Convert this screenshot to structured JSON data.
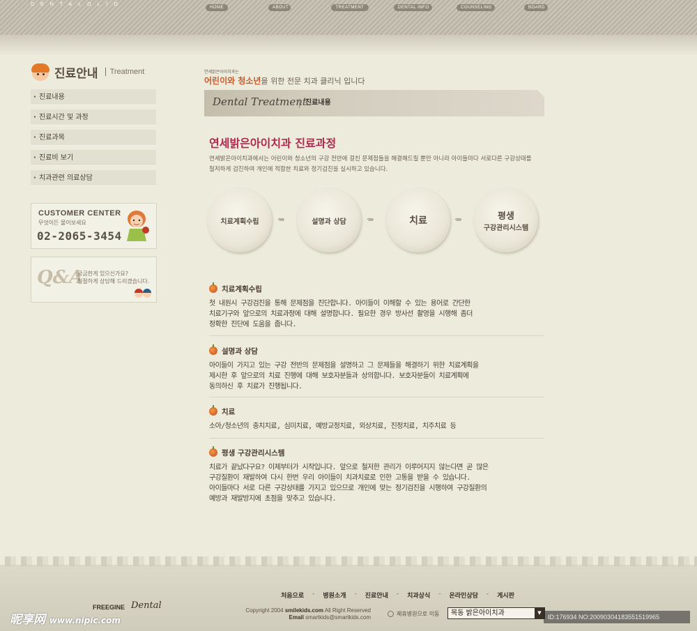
{
  "header": {
    "logo_text": "DENTALOLIO",
    "nav": [
      "HOME",
      "ABOUT",
      "TREATMENT",
      "DENTAL INFO",
      "COUNSELING",
      "BOARD"
    ]
  },
  "sidebar": {
    "title_ko": "진료안내",
    "title_en": "Treatment",
    "items": [
      {
        "label": "진료내용"
      },
      {
        "label": "진료시간 및 과정"
      },
      {
        "label": "진료과목"
      },
      {
        "label": "진료비 보기"
      },
      {
        "label": "치과관련 의료상담"
      }
    ],
    "customer_center": {
      "title": "CUSTOMER CENTER",
      "subtitle": "무엇이든 물어보세요",
      "phone": "02-2065-3454"
    },
    "qa": {
      "logo": "Q&A",
      "line1": "궁금한게 있으신가요?",
      "line2": "친절하게 상담해 드리겠습니다."
    }
  },
  "main": {
    "tagline_small": "연세밝은아이치과는",
    "tagline_highlight": "어린이와 청소년",
    "tagline_rest": "을 위한 전문 치과 클리닉 입니다",
    "title_script": "Dental Treatment",
    "breadcrumb": "진료내용",
    "heading": "연세밝은아이치과 진료과정",
    "intro": "연세밝은아이치과에서는 어린이와 청소년의 구강 전반에 걸친 문제점들을 해결해드릴 뿐만 아니라 아이들마다 서로다른 구강상태를 철저하게 검진하여 개인에 적합한 치료와 정기검진을 실시하고 있습니다.",
    "steps": [
      {
        "label": "치료계획수립"
      },
      {
        "label": "설명과 상담"
      },
      {
        "label": "치료"
      },
      {
        "label1": "평생",
        "label2": "구강관리시스템"
      }
    ],
    "arrow": "·›››",
    "sections": [
      {
        "title": "치료계획수립",
        "lines": [
          "첫 내원시 구강검진을 통해 문제점을 진단합니다. 아이들이 이해할 수 있는 용어로 간단한",
          "치료기구와 앞으로의 치료과정에 대해 설명합니다. 필요한 경우 방사선 촬영을 시행해 좀더",
          "정확한 진단에 도움을 줍니다."
        ]
      },
      {
        "title": "설명과 상담",
        "lines": [
          "아이들이 가지고 있는 구강 전반의 문제점을 설명하고 그 문제들을 해결하기 위한 치료계획을",
          "제시한 후 앞으로의 치료 진행에 대해 보호자분들과 상의합니다. 보호자분들이 치료계획에",
          "동의하신 후 치료가 진행됩니다."
        ]
      },
      {
        "title": "치료",
        "lines": [
          "소아/청소년의 충치치료, 심미치료, 예방교정치료, 외상치료, 진정치료, 치주치료 등"
        ]
      },
      {
        "title": "평생 구강관리시스템",
        "lines": [
          "치료가 끝났다구요? 이제부터가 시작입니다. 앞으로 철저한 관리가 이루어지지 않는다면 곧 많은",
          "구강질환이 재발하여 다시 한번 우리 아이들이 치과치료로 인한 고통을 받을 수 있습니다.",
          "아이들마다 서로 다른 구강상태를 가지고 있으므로 개인에 맞는 정기검진을 시행하여 구강질환의",
          "예방과 재발방지에 초점을 맞추고 있습니다."
        ]
      }
    ]
  },
  "footer": {
    "logo1": "FREEGINE",
    "logo2": "Dental",
    "links": [
      "처음으로",
      "병원소개",
      "진료안내",
      "치과상식",
      "온라인상담",
      "게시판"
    ],
    "separator": "-",
    "copyright_prefix": "Copyright 2004",
    "copyright_site": "smilekids.com",
    "copyright_suffix": "All Right Reserved",
    "email_label": "Email",
    "email": "smartkids@smartkids.com",
    "related_label": "제휴병원으로 이동",
    "related_select": "목동 밝은아이치과"
  },
  "watermark": {
    "left": "昵享网",
    "left_url": "www.nipic.com",
    "id": "ID:176934 NO:20090304183551519965"
  },
  "colors": {
    "background": "#ecebdc",
    "heading": "#b1274f",
    "highlight": "#c85a2c"
  }
}
